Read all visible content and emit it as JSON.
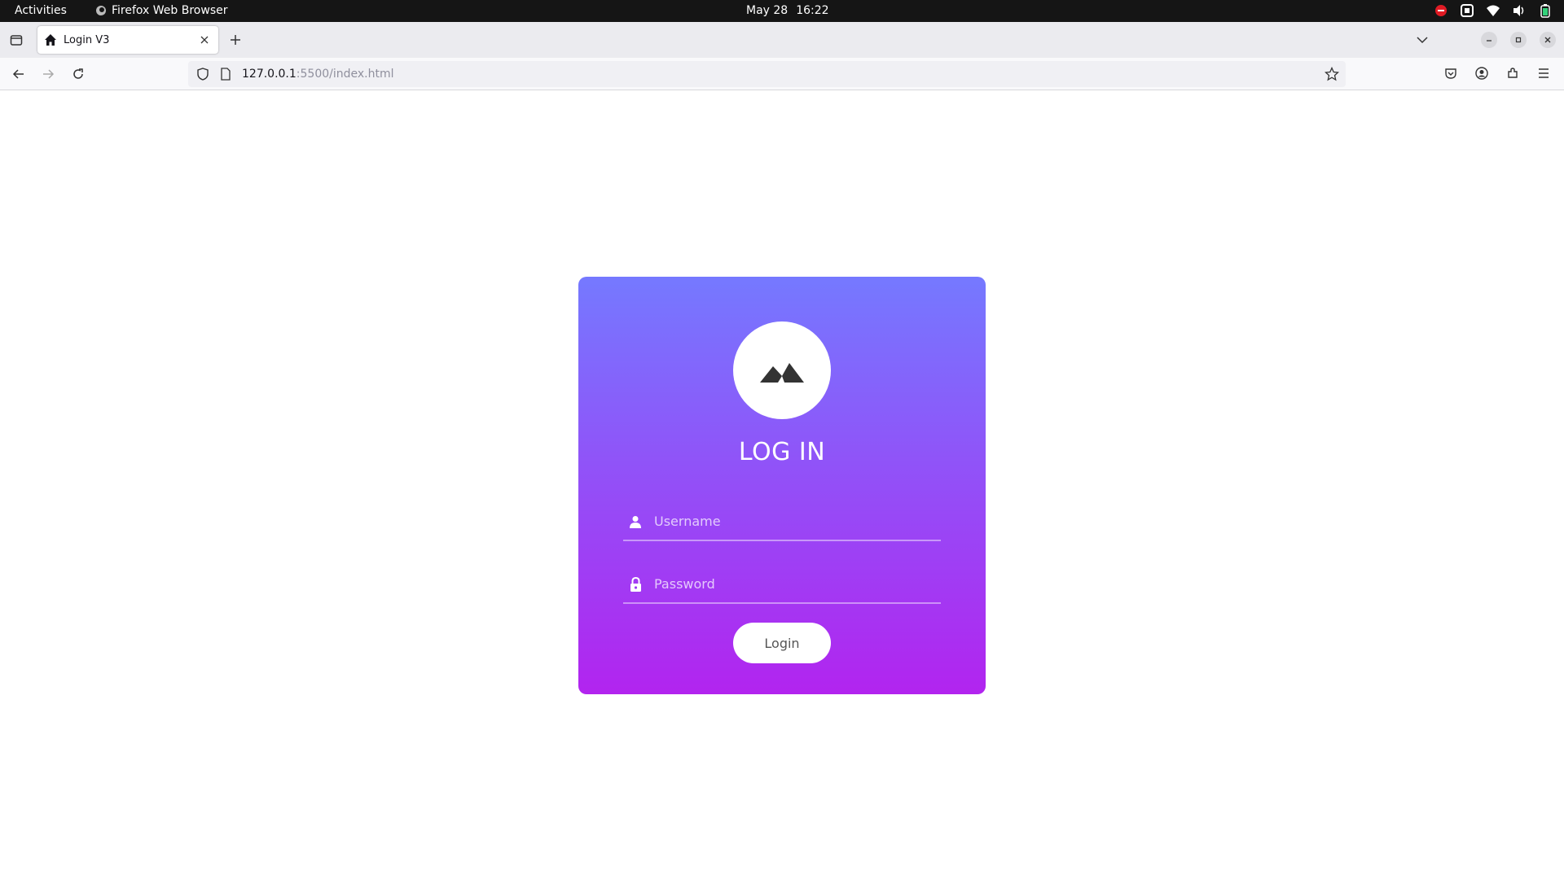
{
  "system_bar": {
    "activities": "Activities",
    "app_name": "Firefox Web Browser",
    "date": "May 28",
    "time": "16:22"
  },
  "browser": {
    "tab": {
      "title": "Login V3",
      "icon": "home-icon"
    },
    "url": {
      "host": "127.0.0.1",
      "rest": ":5500/index.html"
    }
  },
  "login": {
    "title": "LOG IN",
    "username_placeholder": "Username",
    "password_placeholder": "Password",
    "button_label": "Login",
    "gradient": {
      "top": "#7579ff",
      "bottom": "#b224ef"
    }
  }
}
